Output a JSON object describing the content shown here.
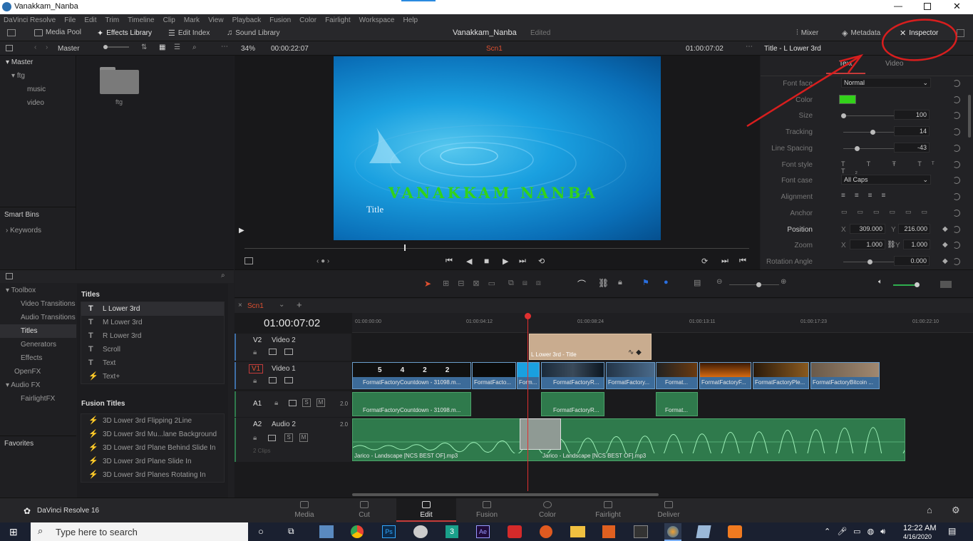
{
  "window": {
    "title": "Vanakkam_Nanba"
  },
  "menu": [
    "DaVinci Resolve",
    "File",
    "Edit",
    "Trim",
    "Timeline",
    "Clip",
    "Mark",
    "View",
    "Playback",
    "Fusion",
    "Color",
    "Fairlight",
    "Workspace",
    "Help"
  ],
  "toolbar": {
    "media_pool": "Media Pool",
    "effects_library": "Effects Library",
    "edit_index": "Edit Index",
    "sound_library": "Sound Library",
    "project_name": "Vanakkam_Nanba",
    "edited": "Edited",
    "mixer": "Mixer",
    "metadata": "Metadata",
    "inspector": "Inspector"
  },
  "media_pool": {
    "bin_label": "Master",
    "tree": [
      "Master",
      "ftg",
      "music",
      "video"
    ],
    "folder": "ftg",
    "smart_bins": "Smart Bins",
    "keywords": "Keywords"
  },
  "viewer": {
    "zoom": "34%",
    "source_tc": "00:00:22:07",
    "timeline_name": "Scn1",
    "record_tc": "01:00:07:02",
    "overlay_main": "VANAKKAM NANBA",
    "overlay_sub": "Title"
  },
  "inspector": {
    "clip_title": "Title - L Lower 3rd",
    "tabs": [
      "Text",
      "Video"
    ],
    "font_face_label": "Font face",
    "font_face": "Normal",
    "color_label": "Color",
    "color_value": "#33d21a",
    "size_label": "Size",
    "size": "100",
    "tracking_label": "Tracking",
    "tracking": "14",
    "line_spacing_label": "Line Spacing",
    "line_spacing": "-43",
    "font_style_label": "Font style",
    "font_case_label": "Font case",
    "font_case": "All Caps",
    "alignment_label": "Alignment",
    "anchor_label": "Anchor",
    "position_label": "Position",
    "pos_x": "309.000",
    "pos_y": "216.000",
    "zoom_label": "Zoom",
    "zoom_x": "1.000",
    "zoom_y": "1.000",
    "rotation_label": "Rotation Angle",
    "rotation": "0.000",
    "x": "X",
    "y": "Y"
  },
  "effects": {
    "toolbox": "Toolbox",
    "items": [
      "Video Transitions",
      "Audio Transitions",
      "Titles",
      "Generators",
      "Effects"
    ],
    "openfx": "OpenFX",
    "audiofx": "Audio FX",
    "fairlightfx": "FairlightFX",
    "favorites": "Favorites",
    "titles_header": "Titles",
    "titles": [
      "L Lower 3rd",
      "M Lower 3rd",
      "R Lower 3rd",
      "Scroll",
      "Text",
      "Text+"
    ],
    "fusion_header": "Fusion Titles",
    "fusion_titles": [
      "3D Lower 3rd Flipping 2Line",
      "3D Lower 3rd Mu...lane Background",
      "3D Lower 3rd Plane Behind Slide In",
      "3D Lower 3rd Plane Slide In",
      "3D Lower 3rd Planes Rotating In"
    ]
  },
  "timeline": {
    "tab": "Scn1",
    "timecode": "01:00:07:02",
    "ruler": [
      "01:00:00:00",
      "01:00:04:12",
      "01:00:08:24",
      "01:00:13:11",
      "01:00:17:23",
      "01:00:22:10"
    ],
    "tracks": {
      "v2_id": "V2",
      "v2_name": "Video 2",
      "v1_id": "V1",
      "v1_name": "Video 1",
      "a1_id": "A1",
      "a2_id": "A2",
      "a2_name": "Audio 2",
      "a_level": "2.0",
      "a2_clips": "2 Clips",
      "s": "S",
      "m": "M"
    },
    "title_clip": "L Lower 3rd - Title",
    "v1_clips": [
      "FormatFactoryCountdown - 31098.m...",
      "FormatFacto...",
      "Form...",
      "FormatFactoryR...",
      "FormatFactory...",
      "Format...",
      "FormatFactoryF...",
      "FormatFactoryPle...",
      "FormatFactoryBitcoin ..."
    ],
    "countdown": [
      "5",
      "4",
      "2",
      "2"
    ],
    "a1_clips": [
      "FormatFactoryCountdown - 31098.m...",
      "FormatFactoryR...",
      "Format..."
    ],
    "a2_clips_names": [
      "Jarico - Landscape [NCS BEST OF].mp3",
      "Jarico - Landscape [NCS BEST OF].mp3"
    ]
  },
  "pages": {
    "app": "DaVinci Resolve 16",
    "items": [
      "Media",
      "Cut",
      "Edit",
      "Fusion",
      "Color",
      "Fairlight",
      "Deliver"
    ],
    "active": "Edit"
  },
  "taskbar": {
    "search": "Type here to search",
    "time": "12:22 AM",
    "date": "4/16/2020"
  }
}
